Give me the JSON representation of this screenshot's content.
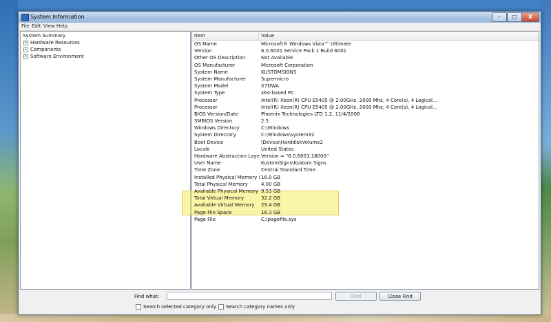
{
  "window": {
    "title": "System Information",
    "controls": {
      "minimize": "–",
      "maximize": "□",
      "close": "X"
    }
  },
  "menu": [
    "File",
    "Edit",
    "View",
    "Help"
  ],
  "tree": {
    "root": "System Summary",
    "children": [
      "Hardware Resources",
      "Components",
      "Software Environment"
    ],
    "expander_symbol": "+"
  },
  "table": {
    "columns": [
      "Item",
      "Value"
    ],
    "rows": [
      [
        "OS Name",
        "Microsoft® Windows Vista™ Ultimate"
      ],
      [
        "Version",
        "6.0.6001 Service Pack 1 Build 6001"
      ],
      [
        "Other OS Description",
        "Not Available"
      ],
      [
        "OS Manufacturer",
        "Microsoft Corporation"
      ],
      [
        "System Name",
        "KUSTOMSIGNS"
      ],
      [
        "System Manufacturer",
        "Supermicro"
      ],
      [
        "System Model",
        "X7DWA"
      ],
      [
        "System Type",
        "x64-based PC"
      ],
      [
        "Processor",
        "Intel(R) Xeon(R) CPU        E5405  @ 2.00GHz, 2000 Mhz, 4 Core(s), 4 Logical..."
      ],
      [
        "Processor",
        "Intel(R) Xeon(R) CPU        E5405  @ 2.00GHz, 2000 Mhz, 4 Core(s), 4 Logical..."
      ],
      [
        "BIOS Version/Date",
        "Phoenix Technologies LTD 1.2, 11/4/2008"
      ],
      [
        "SMBIOS Version",
        "2.5"
      ],
      [
        "Windows Directory",
        "C:\\Windows"
      ],
      [
        "System Directory",
        "C:\\Windows\\system32"
      ],
      [
        "Boot Device",
        "\\Device\\HarddiskVolume2"
      ],
      [
        "Locale",
        "United States"
      ],
      [
        "Hardware Abstraction Layer",
        "Version = \"6.0.6001.18000\""
      ],
      [
        "User Name",
        "KustomSigns\\Kustom Signs"
      ],
      [
        "Time Zone",
        "Central Standard Time"
      ],
      [
        "Installed Physical Memory (RAM)",
        "16.0 GB"
      ],
      [
        "Total Physical Memory",
        "4.00 GB"
      ],
      [
        "Available Physical Memory",
        "9.53 GB"
      ],
      [
        "Total Virtual Memory",
        "32.2 GB"
      ],
      [
        "Available Virtual Memory",
        "29.4 GB"
      ],
      [
        "Page File Space",
        "16.3 GB"
      ],
      [
        "Page File",
        "C:\\pagefile.sys"
      ]
    ]
  },
  "find": {
    "label": "Find what:",
    "value": "",
    "find_button": "Find",
    "close_button": "Close Find",
    "checkbox_selected": "Search selected category only",
    "checkbox_names": "Search category names only"
  },
  "colors": {
    "highlight": "#f8ec60",
    "title_bar": "#a9c4e4",
    "close_button": "#c8452c"
  }
}
